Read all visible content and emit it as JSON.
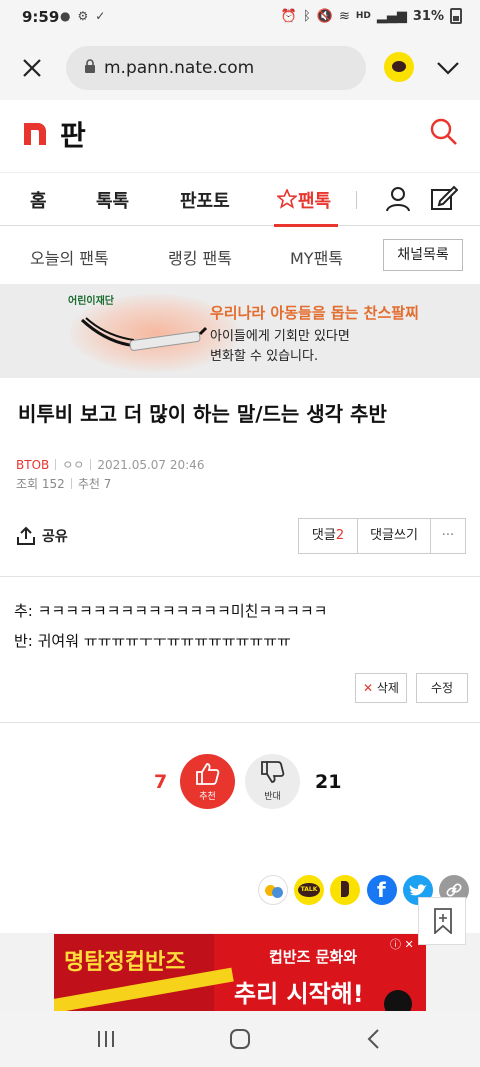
{
  "status_bar": {
    "time": "9:59",
    "battery": "31%",
    "net_label": "HD"
  },
  "browser": {
    "url": "m.pann.nate.com"
  },
  "site": {
    "logo_title": "판",
    "brand_color": "#e8352e"
  },
  "nav": {
    "items": [
      "홈",
      "톡톡",
      "판포토",
      "팬톡"
    ]
  },
  "subnav": {
    "items": [
      "오늘의 팬톡",
      "랭킹 팬톡",
      "MY팬톡"
    ],
    "channel_button": "채널목록"
  },
  "banner": {
    "org": "어린이재단",
    "line1": "우리나라 아동들을 돕는 찬스팔찌",
    "line2": "아이들에게 기회만 있다면",
    "line3": "변화할 수 있습니다."
  },
  "article": {
    "title": "비투비 보고 더 많이 하는 말/드는 생각 추반",
    "category": "BTOB",
    "author": "ㅇㅇ",
    "datetime": "2021.05.07 20:46",
    "views": "조회 152",
    "recommends": "추천 7",
    "share_label": "공유",
    "comment_label": "댓글",
    "comment_count": "2",
    "write_comment": "댓글쓰기",
    "more": "···",
    "body": [
      "추: ㅋㅋㅋㅋㅋㅋㅋㅋㅋㅋㅋㅋㅋㅋ미친ㅋㅋㅋㅋㅋ",
      "반: 귀여워 ㅠㅠㅠㅠㅜㅜㅠㅠㅠㅠㅠㅠㅠㅠㅠ"
    ],
    "delete_label": "삭제",
    "edit_label": "수정"
  },
  "votes": {
    "up_count": "7",
    "up_label": "추천",
    "down_label": "반대",
    "down_count": "21"
  },
  "share_icons": [
    "kakaostory-icon",
    "kakaotalk-icon",
    "kakao-page-icon",
    "facebook-icon",
    "twitter-icon",
    "link-icon"
  ],
  "share_texts": {
    "talk": "TALK"
  },
  "ad": {
    "title": "명탐정컵반즈",
    "text1": "컵반즈 문화와",
    "text2": "추리 시작해!",
    "info": "ⓘ ✕"
  }
}
